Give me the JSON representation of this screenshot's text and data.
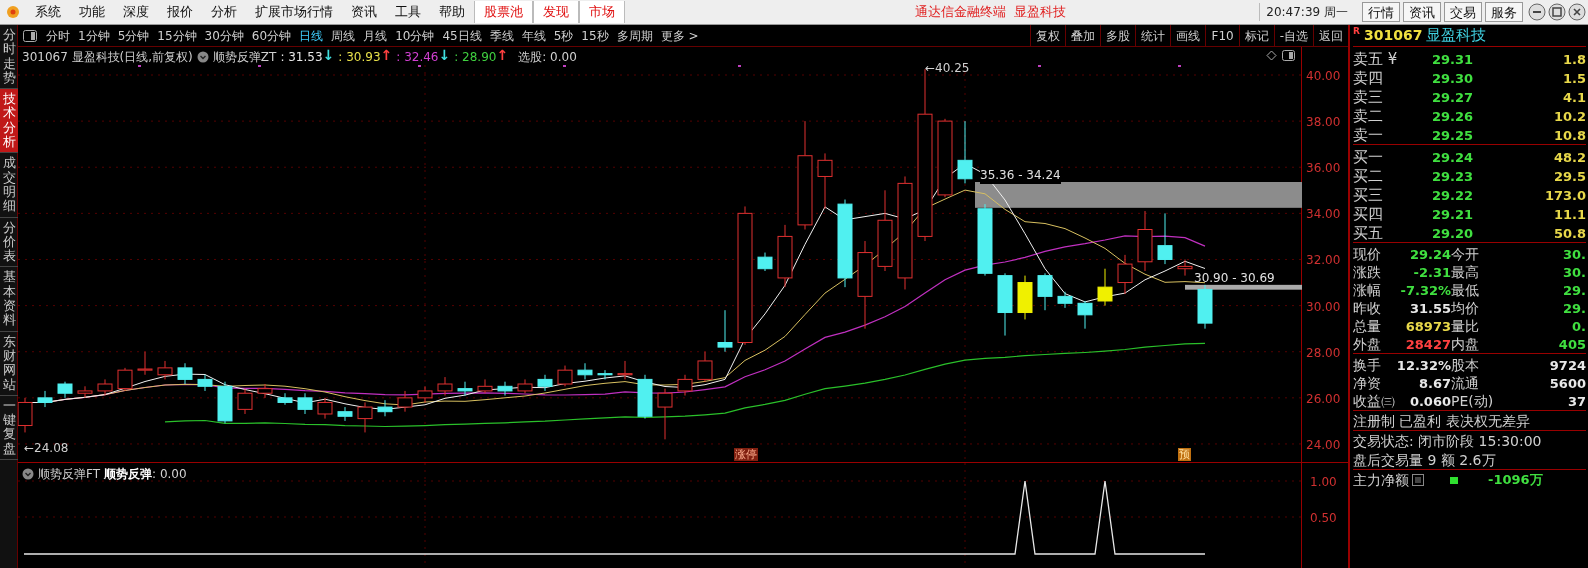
{
  "menu": [
    {
      "label": "系统",
      "highlight": false
    },
    {
      "label": "功能",
      "highlight": false
    },
    {
      "label": "深度",
      "highlight": false
    },
    {
      "label": "报价",
      "highlight": false
    },
    {
      "label": "分析",
      "highlight": false
    },
    {
      "label": "扩展市场行情",
      "highlight": false
    },
    {
      "label": "资讯",
      "highlight": false
    },
    {
      "label": "工具",
      "highlight": false
    },
    {
      "label": "帮助",
      "highlight": false
    },
    {
      "label": "股票池",
      "highlight": true
    },
    {
      "label": "发现",
      "highlight": true
    },
    {
      "label": "市场",
      "highlight": true
    }
  ],
  "title": "通达信金融终端  显盈科技",
  "clock": "20:47:39 周一",
  "top_buttons": [
    "行情",
    "资讯",
    "交易",
    "服务"
  ],
  "side_tabs": [
    {
      "label": "分时走势",
      "selected": false
    },
    {
      "label": "技术分析",
      "selected": true
    },
    {
      "label": "成交明细",
      "selected": false
    },
    {
      "label": "分价表",
      "selected": false
    },
    {
      "label": "基本资料",
      "selected": false
    },
    {
      "label": "东财网站",
      "selected": false
    },
    {
      "label": "一键复盘",
      "selected": false
    }
  ],
  "periods": [
    {
      "label": "分时",
      "selected": false
    },
    {
      "label": "1分钟",
      "selected": false
    },
    {
      "label": "5分钟",
      "selected": false
    },
    {
      "label": "15分钟",
      "selected": false
    },
    {
      "label": "30分钟",
      "selected": false
    },
    {
      "label": "60分钟",
      "selected": false
    },
    {
      "label": "日线",
      "selected": true
    },
    {
      "label": "周线",
      "selected": false
    },
    {
      "label": "月线",
      "selected": false
    },
    {
      "label": "10分钟",
      "selected": false
    },
    {
      "label": "45日线",
      "selected": false
    },
    {
      "label": "季线",
      "selected": false
    },
    {
      "label": "年线",
      "selected": false
    },
    {
      "label": "5秒",
      "selected": false
    },
    {
      "label": "15秒",
      "selected": false
    },
    {
      "label": "多周期",
      "selected": false
    },
    {
      "label": "更多 >",
      "selected": false
    }
  ],
  "tools": [
    "复权",
    "叠加",
    "多股",
    "统计",
    "画线",
    "F10",
    "标记",
    "-自选",
    "返回"
  ],
  "info": {
    "stock": "301067 显盈科技(日线,前复权)",
    "indicator": "顺势反弹ZT",
    "lines": [
      {
        "value": ": 31.53",
        "color": "#e8e8e8",
        "arrow": {
          "text": "↓",
          "color": "#40e0e0"
        }
      },
      {
        "value": ": 30.93",
        "color": "#e8e04a",
        "arrow": {
          "text": "↑",
          "color": "#ff4040"
        }
      },
      {
        "value": ": 32.46",
        "color": "#d040d0",
        "arrow": {
          "text": "↓",
          "color": "#40e0e0"
        }
      },
      {
        "value": ": 28.90",
        "color": "#40d040",
        "arrow": {
          "text": "↑",
          "color": "#ff4040"
        }
      }
    ],
    "pick": "选股: 0.00"
  },
  "chart": {
    "yticks": [
      "40.00",
      "38.00",
      "36.00",
      "34.00",
      "32.00",
      "30.00",
      "28.00",
      "26.00",
      "24.00"
    ],
    "high": "←40.25",
    "low": "←24.08",
    "zones": [
      "35.36 - 34.24",
      "30.90 - 30.69"
    ],
    "markers": [
      "涨停",
      "预"
    ]
  },
  "lower": {
    "indicator": "顺势反弹FT",
    "name": "顺势反弹",
    "value": ": 0.00",
    "yticks": [
      "1.00",
      "0.50"
    ]
  },
  "quote": {
    "flag": "R",
    "code": "301067",
    "name": "显盈科技",
    "sell": [
      {
        "label": "卖五 ¥",
        "price": "29.31",
        "volume": "1.8"
      },
      {
        "label": "卖四",
        "price": "29.30",
        "volume": "1.5"
      },
      {
        "label": "卖三",
        "price": "29.27",
        "volume": "4.1"
      },
      {
        "label": "卖二",
        "price": "29.26",
        "volume": "10.2"
      },
      {
        "label": "卖一",
        "price": "29.25",
        "volume": "10.8"
      }
    ],
    "buy": [
      {
        "label": "买一",
        "price": "29.24",
        "volume": "48.2"
      },
      {
        "label": "买二",
        "price": "29.23",
        "volume": "29.5"
      },
      {
        "label": "买三",
        "price": "29.22",
        "volume": "173.0"
      },
      {
        "label": "买四",
        "price": "29.21",
        "volume": "11.1"
      },
      {
        "label": "买五",
        "price": "29.20",
        "volume": "50.8"
      }
    ],
    "stats": [
      [
        {
          "label": "现价",
          "value": "29.24",
          "color": "#40e040"
        },
        {
          "label": "今开",
          "value": "30.",
          "color": "#40e040"
        }
      ],
      [
        {
          "label": "涨跌",
          "value": "-2.31",
          "color": "#40e040"
        },
        {
          "label": "最高",
          "value": "30.",
          "color": "#40e040"
        }
      ],
      [
        {
          "label": "涨幅",
          "value": "-7.32%",
          "color": "#40e040"
        },
        {
          "label": "最低",
          "value": "29.",
          "color": "#40e040"
        }
      ],
      [
        {
          "label": "昨收",
          "value": "31.55",
          "color": "#e8e8e8"
        },
        {
          "label": "均价",
          "value": "29.",
          "color": "#40e040"
        }
      ],
      [
        {
          "label": "总量",
          "value": "68973",
          "color": "#e8d84a"
        },
        {
          "label": "量比",
          "value": "0.",
          "color": "#40e040"
        }
      ],
      [
        {
          "label": "外盘",
          "value": "28427",
          "color": "#ff4040"
        },
        {
          "label": "内盘",
          "value": "405",
          "color": "#40e040"
        }
      ]
    ],
    "stats2": [
      [
        {
          "label": "换手",
          "value": "12.32%",
          "color": "#e8e8e8"
        },
        {
          "label": "股本",
          "value": "9724",
          "color": "#e8e8e8"
        }
      ],
      [
        {
          "label": "净资",
          "value": "8.67",
          "color": "#e8e8e8"
        },
        {
          "label": "流通",
          "value": "5600",
          "color": "#e8e8e8"
        }
      ],
      [
        {
          "label": "收益㈢",
          "value": "0.060",
          "color": "#e8e8e8"
        },
        {
          "label": "PE(动)",
          "value": "37",
          "color": "#e8e8e8"
        }
      ]
    ],
    "tags": "注册制 已盈利 表决权无差异",
    "status": "交易状态: 闭市阶段 15:30:00",
    "after_hours": "盘后交易量 9 额 2.6万",
    "net_flow": {
      "label": "主力净额",
      "value": "-1096万"
    }
  }
}
